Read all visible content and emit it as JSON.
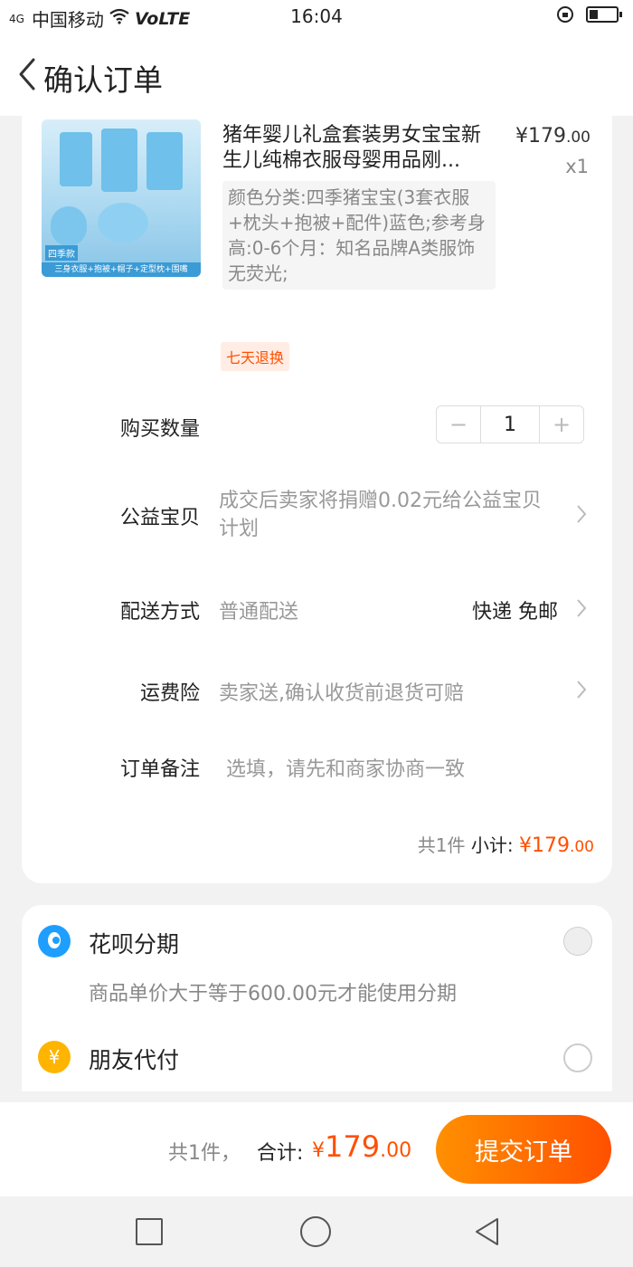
{
  "status_bar": {
    "network": "4G",
    "carrier": "中国移动",
    "volte": "VoLTE",
    "time": "16:04"
  },
  "nav": {
    "title": "确认订单"
  },
  "product": {
    "title": "猪年婴儿礼盒套装男女宝宝新生儿纯棉衣服母婴用品刚...",
    "price_int": "¥179",
    "price_dec": ".00",
    "quantity_tag": "x1",
    "sku": "颜色分类:四季猪宝宝(3套衣服+枕头+抱被+配件)蓝色;参考身高:0-6个月：知名品牌A类服饰无荧光;",
    "thumb_tag": "四季款",
    "thumb_strip": "三身衣服+抱被+帽子+定型枕+围嘴",
    "badge": "七天退换"
  },
  "rows": {
    "quantity_label": "购买数量",
    "quantity_value": "1",
    "minus": "−",
    "plus": "+",
    "charity_label": "公益宝贝",
    "charity_value": "成交后卖家将捐赠0.02元给公益宝贝计划",
    "delivery_label": "配送方式",
    "delivery_value": "普通配送",
    "delivery_express": "快递 免邮",
    "insurance_label": "运费险",
    "insurance_value": "卖家送,确认收货前退货可赔",
    "remark_label": "订单备注",
    "remark_placeholder": "选填，请先和商家协商一致"
  },
  "subtotal": {
    "count": "共1件",
    "label": "小计:",
    "amount_int": "¥179",
    "amount_dec": ".00"
  },
  "payment": {
    "huabei_title": "花呗分期",
    "huabei_note": "商品单价大于等于600.00元才能使用分期",
    "friend_title": "朋友代付",
    "friend_icon_glyph": "¥"
  },
  "bottom": {
    "count": "共1件，",
    "total_label": "合计:",
    "currency": "¥",
    "amount_int": "179",
    "amount_dec": ".00",
    "submit": "提交订单"
  },
  "colors": {
    "accent": "#ff5000",
    "accent_start": "#ff9000",
    "huabei_blue": "#1e9fff",
    "friend_yellow": "#ffb400"
  }
}
